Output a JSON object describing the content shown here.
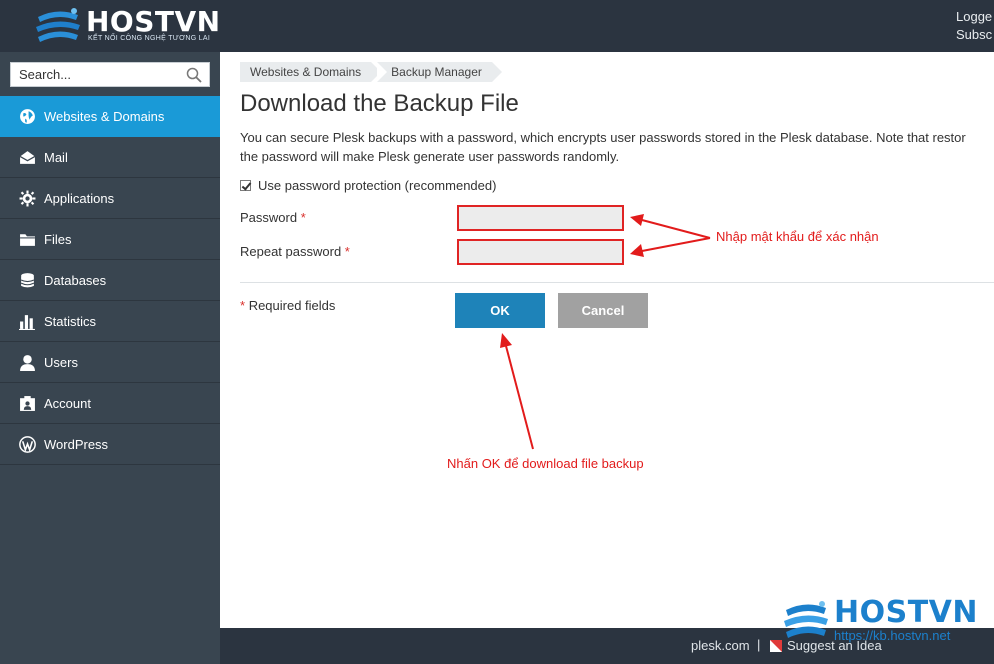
{
  "header": {
    "logo_text": "HOSTVN",
    "logo_tagline": "KẾT NỐI CÔNG NGHỆ TƯƠNG LAI",
    "user_line1": "Logge",
    "user_line2": "Subsc"
  },
  "sidebar": {
    "search_placeholder": "Search...",
    "items": [
      {
        "label": "Websites & Domains",
        "icon": "globe-icon",
        "active": true
      },
      {
        "label": "Mail",
        "icon": "mail-icon"
      },
      {
        "label": "Applications",
        "icon": "gear-icon"
      },
      {
        "label": "Files",
        "icon": "folder-icon"
      },
      {
        "label": "Databases",
        "icon": "database-icon"
      },
      {
        "label": "Statistics",
        "icon": "bar-chart-icon"
      },
      {
        "label": "Users",
        "icon": "user-icon"
      },
      {
        "label": "Account",
        "icon": "account-icon"
      },
      {
        "label": "WordPress",
        "icon": "wordpress-icon"
      }
    ]
  },
  "main": {
    "breadcrumb": [
      "Websites & Domains",
      "Backup Manager"
    ],
    "title": "Download the Backup File",
    "description_line1": "You can secure Plesk backups with a password, which encrypts user passwords stored in the Plesk database. Note that restor",
    "description_line2": "the password will make Plesk generate user passwords randomly.",
    "checkbox_label": "Use password protection (recommended)",
    "checkbox_checked": true,
    "password_label": "Password",
    "repeat_password_label": "Repeat password",
    "required_star": "*",
    "required_note": "Required fields",
    "ok_label": "OK",
    "cancel_label": "Cancel"
  },
  "annotations": {
    "password_note": "Nhập mật khẩu để xác nhận",
    "ok_note": "Nhấn OK để download file backup",
    "color": "#e21b1b"
  },
  "footer": {
    "link1": "plesk.com",
    "separator": "|",
    "link2": "Suggest an Idea"
  },
  "watermark": {
    "brand": "HOSTVN",
    "url": "https://kb.hostvn.net"
  },
  "colors": {
    "topbar": "#2b3440",
    "sidebar": "#394550",
    "active_nav": "#1a9ad7",
    "ok_button": "#1e83b9",
    "cancel_button": "#a1a1a1"
  }
}
